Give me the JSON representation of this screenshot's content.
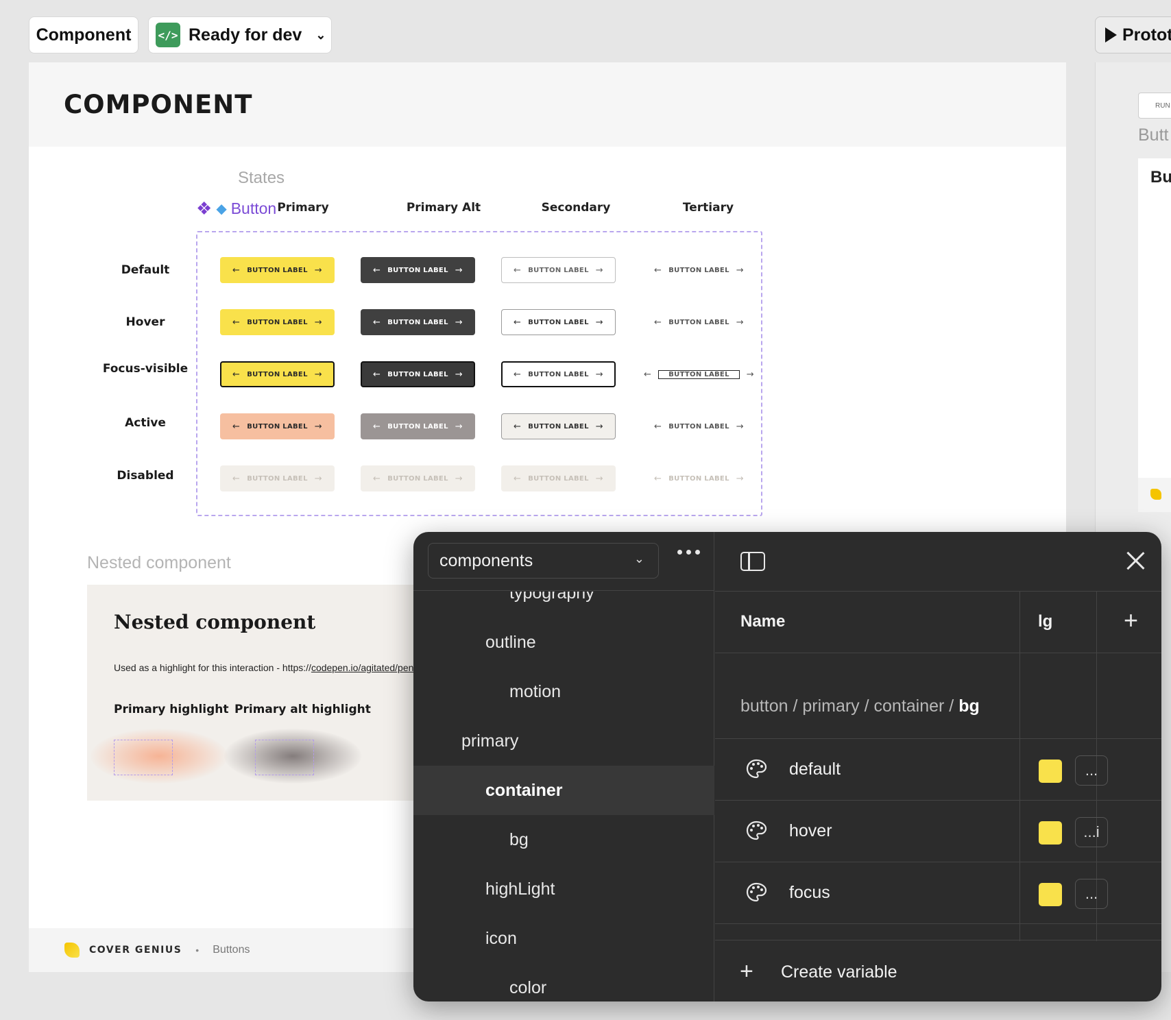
{
  "toolbar": {
    "component_chip": "Component",
    "status_chip": "Ready for dev",
    "prototype_chip": "Protot"
  },
  "frame": {
    "title": "COMPONENT",
    "states_label": "States",
    "component_tag": "Button",
    "columns": [
      "Primary",
      "Primary Alt",
      "Secondary",
      "Tertiary"
    ],
    "rows": [
      "Default",
      "Hover",
      "Focus-visible",
      "Active",
      "Disabled"
    ],
    "button_label": "BUTTON LABEL",
    "nested_label": "Nested component",
    "nested_card": {
      "title": "Nested component",
      "desc_prefix": "Used as a highlight for this interaction - https://",
      "desc_link": "codepen.io/agitated/pen",
      "highlights": [
        "Primary highlight",
        "Primary alt highlight"
      ]
    },
    "footer": {
      "brand": "COVER GENIUS",
      "separator": "•",
      "page": "Buttons"
    }
  },
  "side_frame": {
    "run_label": "RUN",
    "title": "Butt",
    "card_title": "Bu"
  },
  "variables_panel": {
    "collection": "components",
    "tree": [
      {
        "label": "typography",
        "indent": 2
      },
      {
        "label": "outline",
        "indent": 1
      },
      {
        "label": "motion",
        "indent": 2
      },
      {
        "label": "primary",
        "indent": 0
      },
      {
        "label": "container",
        "indent": 1,
        "selected": true
      },
      {
        "label": "bg",
        "indent": 2
      },
      {
        "label": "highLight",
        "indent": 1
      },
      {
        "label": "icon",
        "indent": 1
      },
      {
        "label": "color",
        "indent": 2
      }
    ],
    "header_name": "Name",
    "header_mode": "lg",
    "group_path": "button / primary / container / ",
    "group_leaf": "bg",
    "variables": [
      {
        "name": "default",
        "value": "...",
        "swatch": "#f9e14b"
      },
      {
        "name": "hover",
        "value": "...i",
        "swatch": "#f9e14b"
      },
      {
        "name": "focus",
        "value": "...",
        "swatch": "#f9e14b"
      }
    ],
    "create_label": "Create variable"
  },
  "colors": {
    "primary_yellow": "#f9e14b",
    "primary_alt": "#404040",
    "active_peach": "#f6bfa0",
    "selection_purple": "#7b4bd6",
    "panel_bg": "#2c2c2c",
    "dev_green": "#3e9b5b"
  }
}
